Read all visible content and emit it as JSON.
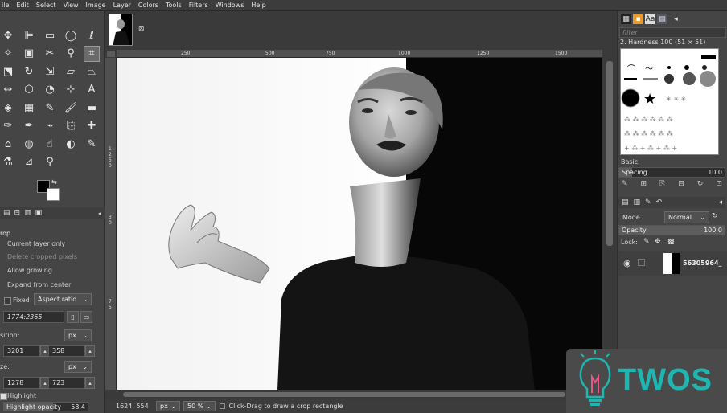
{
  "menu": [
    "ile",
    "Edit",
    "Select",
    "View",
    "Image",
    "Layer",
    "Colors",
    "Tools",
    "Filters",
    "Windows",
    "Help"
  ],
  "toolbox": {
    "tools": [
      {
        "icon": "move-icon",
        "glyph": "✥"
      },
      {
        "icon": "align-icon",
        "glyph": "⊫"
      },
      {
        "icon": "rect-select-icon",
        "glyph": "▭"
      },
      {
        "icon": "ellipse-select-icon",
        "glyph": "◯"
      },
      {
        "icon": "free-select-icon",
        "glyph": "ℓ"
      },
      {
        "icon": "fuzzy-select-icon",
        "glyph": "✧"
      },
      {
        "icon": "color-select-icon",
        "glyph": "▣"
      },
      {
        "icon": "scissors-select-icon",
        "glyph": "✂"
      },
      {
        "icon": "foreground-select-icon",
        "glyph": "⚲"
      },
      {
        "icon": "crop-icon",
        "glyph": "⌗"
      },
      {
        "icon": "unified-transform-icon",
        "glyph": "⬔"
      },
      {
        "icon": "rotate-icon",
        "glyph": "↻"
      },
      {
        "icon": "scale-icon",
        "glyph": "⇲"
      },
      {
        "icon": "shear-icon",
        "glyph": "▱"
      },
      {
        "icon": "perspective-icon",
        "glyph": "⏢"
      },
      {
        "icon": "flip-icon",
        "glyph": "⇔"
      },
      {
        "icon": "cage-icon",
        "glyph": "⬡"
      },
      {
        "icon": "warp-icon",
        "glyph": "◔"
      },
      {
        "icon": "handle-transform-icon",
        "glyph": "⊹"
      },
      {
        "icon": "text-icon",
        "glyph": "A"
      },
      {
        "icon": "bucket-fill-icon",
        "glyph": "◈"
      },
      {
        "icon": "gradient-icon",
        "glyph": "▦"
      },
      {
        "icon": "pencil-icon",
        "glyph": "✎"
      },
      {
        "icon": "paintbrush-icon",
        "glyph": "🖌"
      },
      {
        "icon": "eraser-icon",
        "glyph": "▬"
      },
      {
        "icon": "airbrush-icon",
        "glyph": "✑"
      },
      {
        "icon": "ink-icon",
        "glyph": "✒"
      },
      {
        "icon": "mypaint-brush-icon",
        "glyph": "⌁"
      },
      {
        "icon": "clone-icon",
        "glyph": "⎘"
      },
      {
        "icon": "heal-icon",
        "glyph": "✚"
      },
      {
        "icon": "perspective-clone-icon",
        "glyph": "⌂"
      },
      {
        "icon": "blur-icon",
        "glyph": "◍"
      },
      {
        "icon": "smudge-icon",
        "glyph": "☝"
      },
      {
        "icon": "dodge-burn-icon",
        "glyph": "◐"
      },
      {
        "icon": "paths-icon",
        "glyph": "✎"
      },
      {
        "icon": "color-picker-icon",
        "glyph": "⚗"
      },
      {
        "icon": "measure-icon",
        "glyph": "⊿"
      },
      {
        "icon": "zoom-icon",
        "glyph": "⚲"
      }
    ],
    "fg_color": "#000000",
    "bg_color": "#ffffff"
  },
  "options": {
    "title": "rop",
    "current_layer_only": "Current layer only",
    "delete_cropped": "Delete cropped pixels",
    "allow_growing": "Allow growing",
    "expand_from_center": "Expand from center",
    "fixed_label": "Fixed",
    "aspect_mode": "Aspect ratio",
    "ratio_value": "1774:2365",
    "position_label": "sition:",
    "position_unit": "px",
    "pos_x": "3201",
    "pos_y": "358",
    "size_label": "ze:",
    "size_unit": "px",
    "size_w": "1278",
    "size_h": "723",
    "highlight": "Highlight",
    "highlight_opacity_label": "Highlight opacity",
    "highlight_opacity_value": "58.4"
  },
  "rulers": {
    "h": [
      "250",
      "500",
      "750",
      "1000",
      "1250",
      "1500"
    ],
    "v": [
      "1",
      "2",
      "5",
      "0",
      "3",
      "0",
      "7",
      "5"
    ]
  },
  "status": {
    "coords": "1624, 554",
    "unit": "px",
    "zoom": "50 %",
    "message": "Click-Drag to draw a crop rectangle"
  },
  "right": {
    "filter_placeholder": "filter",
    "brush_name": "2. Hardness 100 (51 × 51)",
    "brush_set": "Basic,",
    "spacing_label": "Spacing",
    "spacing_value": "10.0",
    "mode_label": "Mode",
    "mode_value": "Normal",
    "opacity_label": "Opacity",
    "opacity_value": "100.0",
    "lock_label": "Lock:",
    "layer_name": "56305964_"
  },
  "watermark": {
    "text": "TWOS"
  },
  "colors": {
    "accent": "#1fb5b0",
    "panel": "#454545",
    "canvas_bg": "#3a3a3a"
  }
}
